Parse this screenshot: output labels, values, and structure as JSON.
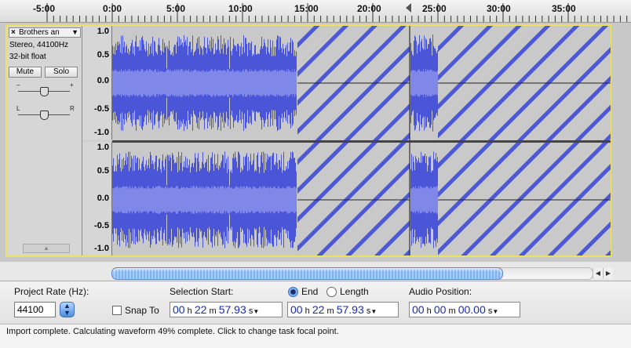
{
  "ruler": {
    "labels": [
      "-5:00",
      "0:00",
      "5:00",
      "10:00",
      "15:00",
      "20:00",
      "25:00",
      "30:00",
      "35:00"
    ]
  },
  "track": {
    "name": "Brothers an",
    "close_symbol": "×",
    "menu_arrow": "▼",
    "format": "Stereo, 44100Hz",
    "sample": "32-bit float",
    "mute_label": "Mute",
    "solo_label": "Solo",
    "gain_minus": "–",
    "gain_plus": "+",
    "pan_left": "L",
    "pan_right": "R",
    "collapse_icon": "▲"
  },
  "vruler_labels": [
    "1.0",
    "0.5",
    "0.0",
    "-0.5",
    "-1.0"
  ],
  "waveform": {
    "wave_color": "#4a55d8",
    "rms_color": "#7f87e8",
    "pending_color": "#5a66d6",
    "background": "#c9c9c9"
  },
  "bottom": {
    "project_rate_label": "Project Rate (Hz):",
    "project_rate_value": "44100",
    "snap_label": "Snap To",
    "selection_start_label": "Selection Start:",
    "end_label": "End",
    "length_label": "Length",
    "audio_position_label": "Audio Position:",
    "sel_start": {
      "h": "00",
      "m": "22",
      "s": "57.93"
    },
    "sel_end": {
      "h": "00",
      "m": "22",
      "s": "57.93"
    },
    "audio_pos": {
      "h": "00",
      "m": "00",
      "s": "00.00"
    },
    "unit_h": "h",
    "unit_m": "m",
    "unit_s": "s"
  },
  "status": {
    "text": "Import complete. Calculating waveform 49% complete.  Click to change task focal point."
  }
}
